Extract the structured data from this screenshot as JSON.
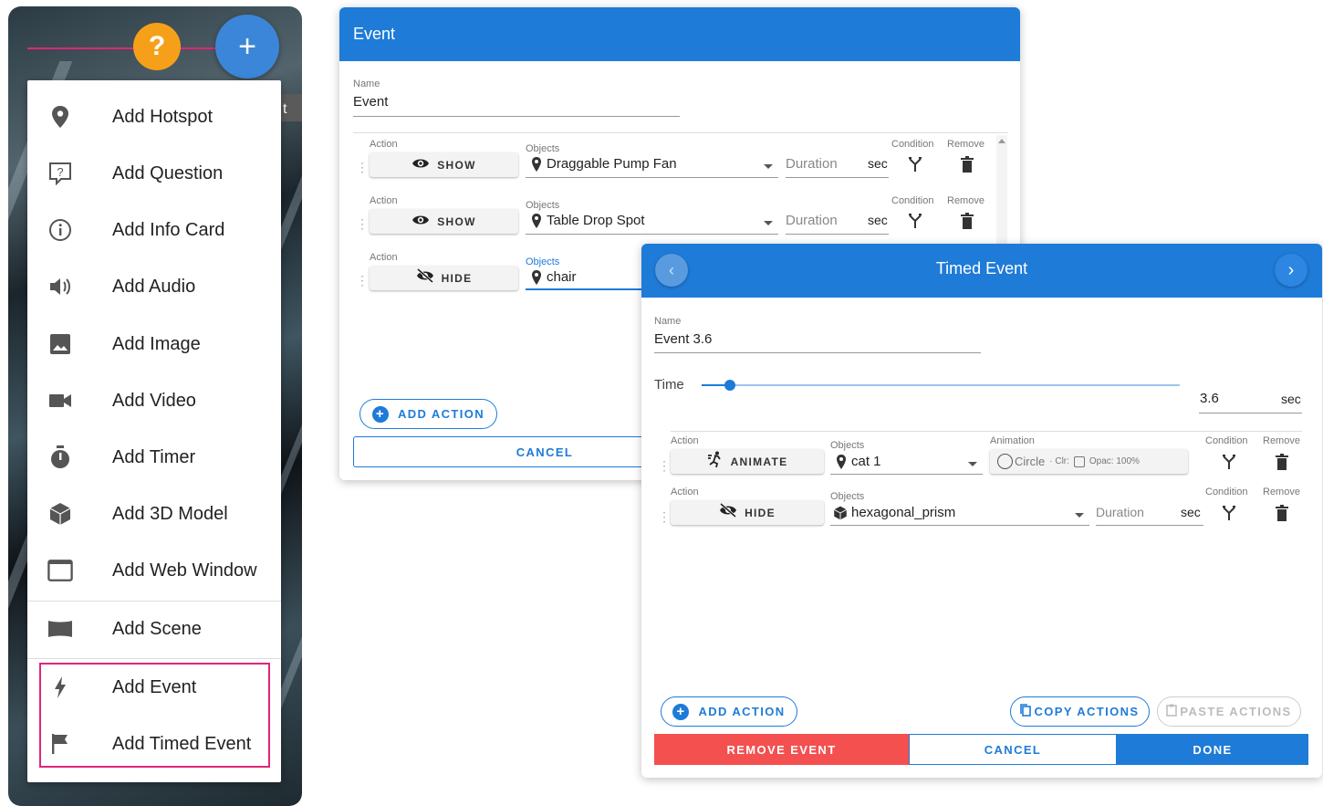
{
  "fab": {
    "help": "?",
    "add": "+"
  },
  "menu": {
    "items": [
      {
        "label": "Add Hotspot",
        "icon": "map-pin-icon"
      },
      {
        "label": "Add Question",
        "icon": "question-box-icon"
      },
      {
        "label": "Add Info Card",
        "icon": "info-icon"
      },
      {
        "label": "Add Audio",
        "icon": "speaker-icon"
      },
      {
        "label": "Add Image",
        "icon": "image-icon"
      },
      {
        "label": "Add Video",
        "icon": "video-camera-icon"
      },
      {
        "label": "Add Timer",
        "icon": "stopwatch-icon"
      },
      {
        "label": "Add 3D Model",
        "icon": "cube-icon"
      },
      {
        "label": "Add Web Window",
        "icon": "window-icon"
      },
      {
        "label": "Add Scene",
        "icon": "scene-icon"
      },
      {
        "label": "Add Event",
        "icon": "lightning-icon"
      },
      {
        "label": "Add Timed Event",
        "icon": "flag-icon"
      }
    ],
    "peek_text": "t"
  },
  "event_dialog": {
    "title": "Event",
    "name_label": "Name",
    "name_value": "Event",
    "rows": [
      {
        "action_label": "Action",
        "action": "SHOW",
        "objects_label": "Objects",
        "object": "Draggable Pump Fan",
        "duration_placeholder": "Duration",
        "unit": "sec",
        "condition_label": "Condition",
        "remove_label": "Remove"
      },
      {
        "action_label": "Action",
        "action": "SHOW",
        "objects_label": "Objects",
        "object": "Table Drop Spot",
        "duration_placeholder": "Duration",
        "unit": "sec",
        "condition_label": "Condition",
        "remove_label": "Remove"
      },
      {
        "action_label": "Action",
        "action": "HIDE",
        "objects_label": "Objects",
        "object": "chair"
      }
    ],
    "add_action": "ADD ACTION",
    "cancel": "CANCEL"
  },
  "timed_dialog": {
    "title": "Timed Event",
    "name_label": "Name",
    "name_value": "Event 3.6",
    "time_label": "Time",
    "time_value": "3.6",
    "time_unit": "sec",
    "slider_fraction": 0.06,
    "rows": [
      {
        "action_label": "Action",
        "action": "ANIMATE",
        "objects_label": "Objects",
        "object": "cat 1",
        "animation_label": "Animation",
        "animation": "Circle",
        "clr": "· Clr:",
        "opac": "Opac: 100%",
        "condition_label": "Condition",
        "remove_label": "Remove"
      },
      {
        "action_label": "Action",
        "action": "HIDE",
        "objects_label": "Objects",
        "object": "hexagonal_prism",
        "duration_placeholder": "Duration",
        "unit": "sec",
        "condition_label": "Condition",
        "remove_label": "Remove"
      }
    ],
    "add_action": "ADD ACTION",
    "copy_actions": "COPY ACTIONS",
    "paste_actions": "PASTE ACTIONS",
    "remove_event": "REMOVE EVENT",
    "cancel": "CANCEL",
    "done": "DONE"
  },
  "colors": {
    "primary": "#1e7bd8",
    "danger": "#f45050",
    "help": "#f6a01a",
    "highlight": "#e0257a"
  }
}
